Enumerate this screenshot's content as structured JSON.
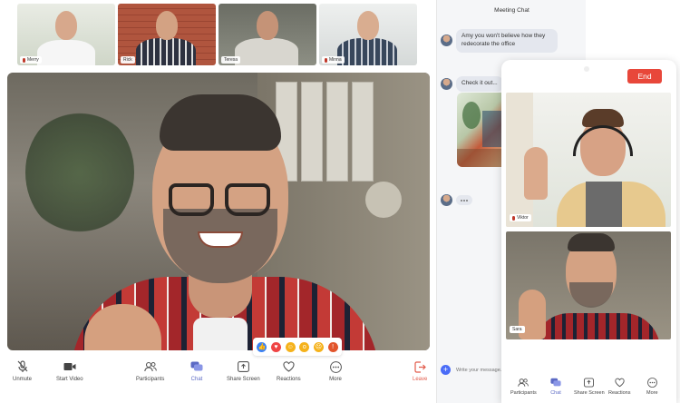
{
  "thumbnails": [
    {
      "name": "Merry",
      "muted": true
    },
    {
      "name": "Rick",
      "muted": false
    },
    {
      "name": "Teresa",
      "muted": false
    },
    {
      "name": "Minna",
      "muted": true
    }
  ],
  "reactions": [
    "thumbs-up",
    "heart",
    "laugh",
    "wow",
    "sad",
    "angry"
  ],
  "toolbar": {
    "unmute": "Unmute",
    "start_video": "Start Video",
    "participants": "Participants",
    "chat": "Chat",
    "share_screen": "Share Screen",
    "reactions": "Reactions",
    "more": "More",
    "leave": "Leave"
  },
  "chat": {
    "title": "Meeting Chat",
    "messages": [
      "Amy you won't believe how they redecorate the office",
      "Check it out..."
    ],
    "input_placeholder": "Write your message..."
  },
  "mobile": {
    "end_label": "End",
    "videos": [
      {
        "name": "Viktor",
        "muted": true
      },
      {
        "name": "Sara",
        "muted": false
      }
    ],
    "toolbar": {
      "participants": "Participants",
      "chat": "Chat",
      "share_screen": "Share Screen",
      "reactions": "Reactions",
      "more": "More"
    }
  },
  "colors": {
    "accent": "#5c6ac4",
    "end": "#e8473a",
    "leave": "#e25b4b",
    "bubble": "#e4e7ee"
  }
}
